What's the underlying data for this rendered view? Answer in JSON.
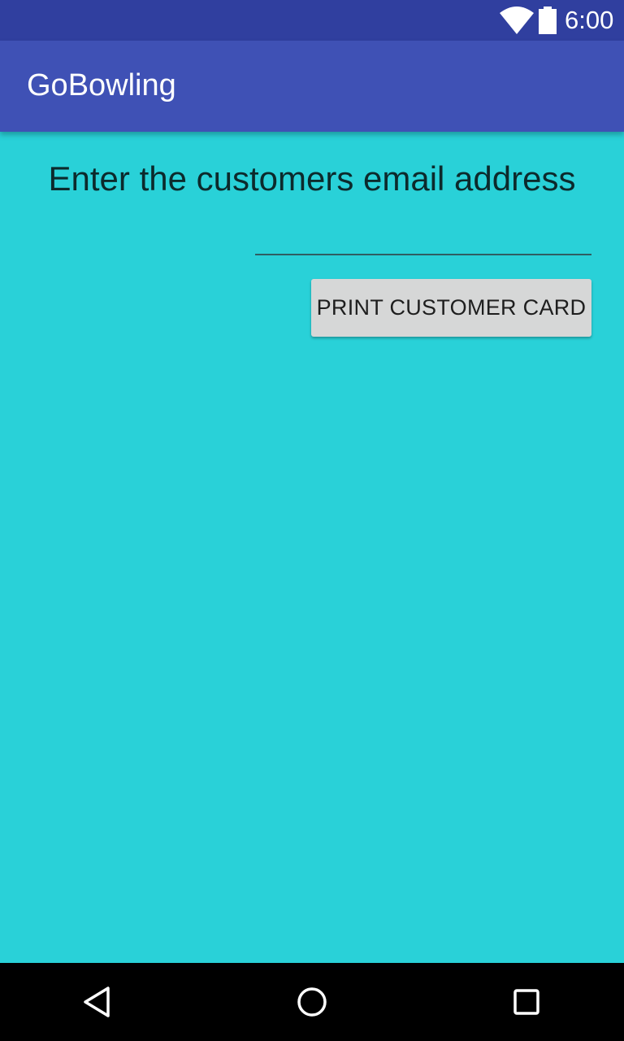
{
  "status_bar": {
    "time": "6:00",
    "icons": [
      "wifi-icon",
      "battery-icon"
    ]
  },
  "app_bar": {
    "title": "GoBowling",
    "background": "#3f51b5"
  },
  "main": {
    "background": "#29d1d8",
    "prompt": "Enter the customers email address",
    "email_input": {
      "value": "",
      "placeholder": ""
    },
    "print_button_label": "PRINT CUSTOMER CARD"
  },
  "nav_bar": {
    "icons": [
      "back-icon",
      "home-icon",
      "recents-icon"
    ]
  }
}
